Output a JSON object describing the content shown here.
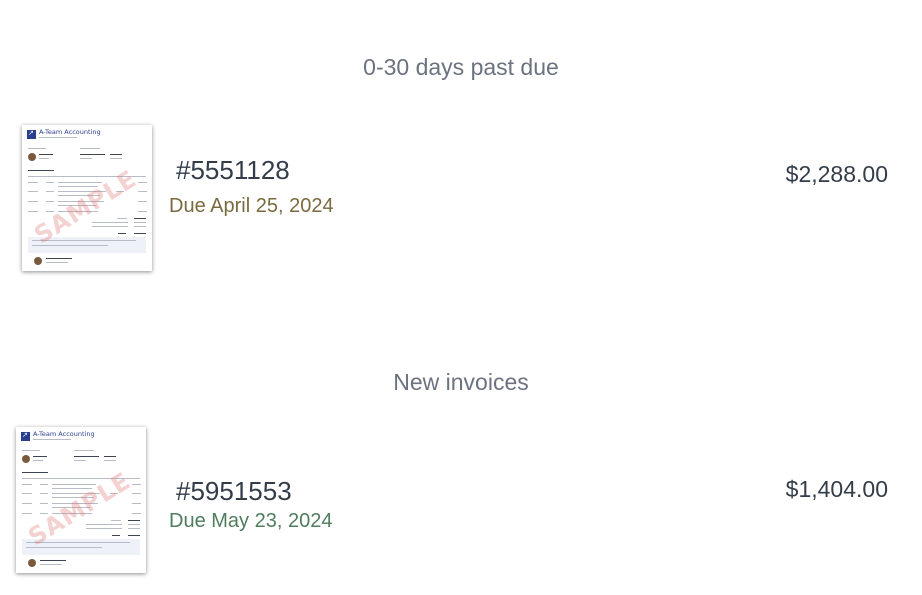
{
  "sections": [
    {
      "title": "0-30 days past due",
      "invoice": {
        "number": "#5551128",
        "due": "Due April 25, 2024",
        "amount": "$2,288.00",
        "due_color": "#7a6a3f",
        "thumbnail": {
          "company": "A-Team Accounting",
          "stamp": "SAMPLE"
        }
      }
    },
    {
      "title": "New invoices",
      "invoice": {
        "number": "#5951553",
        "due": "Due May 23, 2024",
        "amount": "$1,404.00",
        "due_color": "#4f7d5e",
        "thumbnail": {
          "company": "A-Team Accounting",
          "stamp": "SAMPLE"
        }
      }
    }
  ]
}
